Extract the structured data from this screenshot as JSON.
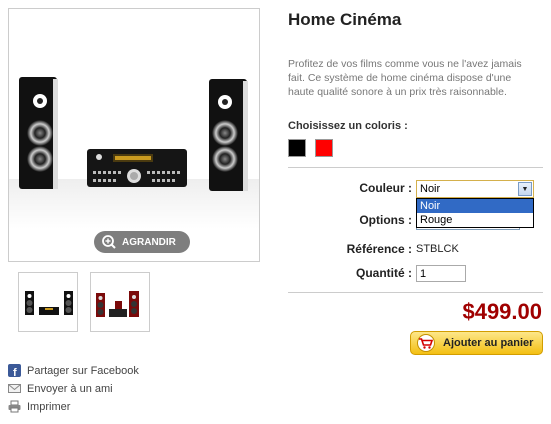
{
  "product": {
    "title": "Home Cinéma",
    "description": "Profitez de vos films comme vous ne l'avez jamais fait. Ce système de home cinéma dispose d'une haute qualité sonore à un prix très raisonnable.",
    "zoom_label": "AGRANDIR"
  },
  "colors": {
    "label": "Choisissez un coloris :",
    "swatches": [
      {
        "name": "Noir",
        "hex": "#000000"
      },
      {
        "name": "Rouge",
        "hex": "#ff0000"
      }
    ]
  },
  "form": {
    "couleur_label": "Couleur :",
    "couleur_value": "Noir",
    "couleur_options": [
      "Noir",
      "Rouge"
    ],
    "options_label": "Options :",
    "reference_label": "Référence :",
    "reference_value": "STBLCK",
    "quantite_label": "Quantité :",
    "quantite_value": "1"
  },
  "price": "$499.00",
  "cart_button": "Ajouter au panier",
  "links": {
    "facebook": "Partager sur Facebook",
    "email": "Envoyer à un ami",
    "print": "Imprimer"
  },
  "theme": {
    "price_color": "#a00000",
    "button_color": "#f3bf13",
    "highlight": "#316ac5"
  }
}
